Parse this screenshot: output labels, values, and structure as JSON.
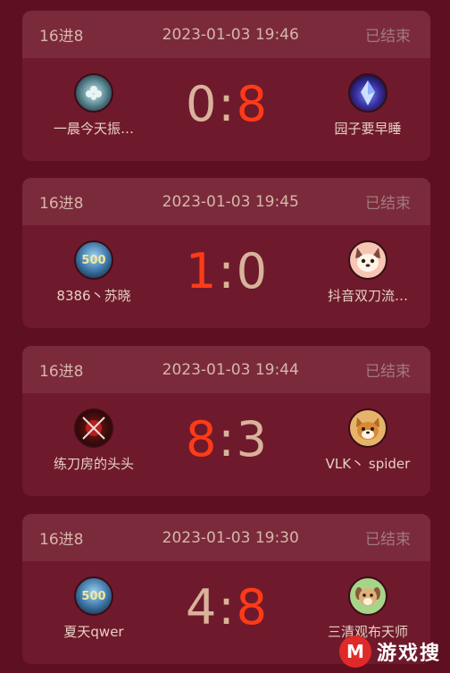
{
  "matches": [
    {
      "stage": "16进8",
      "time": "2023-01-03 19:46",
      "status": "已结束",
      "left": {
        "name": "一晨今天振…",
        "score": "0",
        "icon": "snowflake-flower-icon"
      },
      "right": {
        "name": "园子要早睡",
        "score": "8",
        "icon": "blue-crystal-icon"
      }
    },
    {
      "stage": "16进8",
      "time": "2023-01-03 19:45",
      "status": "已结束",
      "left": {
        "name": "8386丶苏晓",
        "score": "1",
        "icon": "500-badge-icon"
      },
      "right": {
        "name": "抖音双刀流…",
        "score": "0",
        "icon": "cartoon-dog-icon"
      }
    },
    {
      "stage": "16进8",
      "time": "2023-01-03 19:44",
      "status": "已结束",
      "left": {
        "name": "练刀房的头头",
        "score": "8",
        "icon": "katana-icon"
      },
      "right": {
        "name": "VLK丶 spider",
        "score": "3",
        "icon": "shiba-dog-icon"
      }
    },
    {
      "stage": "16进8",
      "time": "2023-01-03 19:30",
      "status": "已结束",
      "left": {
        "name": "夏天qwer",
        "score": "4",
        "icon": "500-badge-icon"
      },
      "right": {
        "name": "三清观布天师",
        "score": "8",
        "icon": "dog-character-icon"
      }
    }
  ],
  "watermark": {
    "logo": "M",
    "text": "游戏搜"
  },
  "colors": {
    "win": "#ff3b17",
    "lose": "#d8b39a",
    "card": "#6e1a2c",
    "header": "#7b2a3c"
  }
}
